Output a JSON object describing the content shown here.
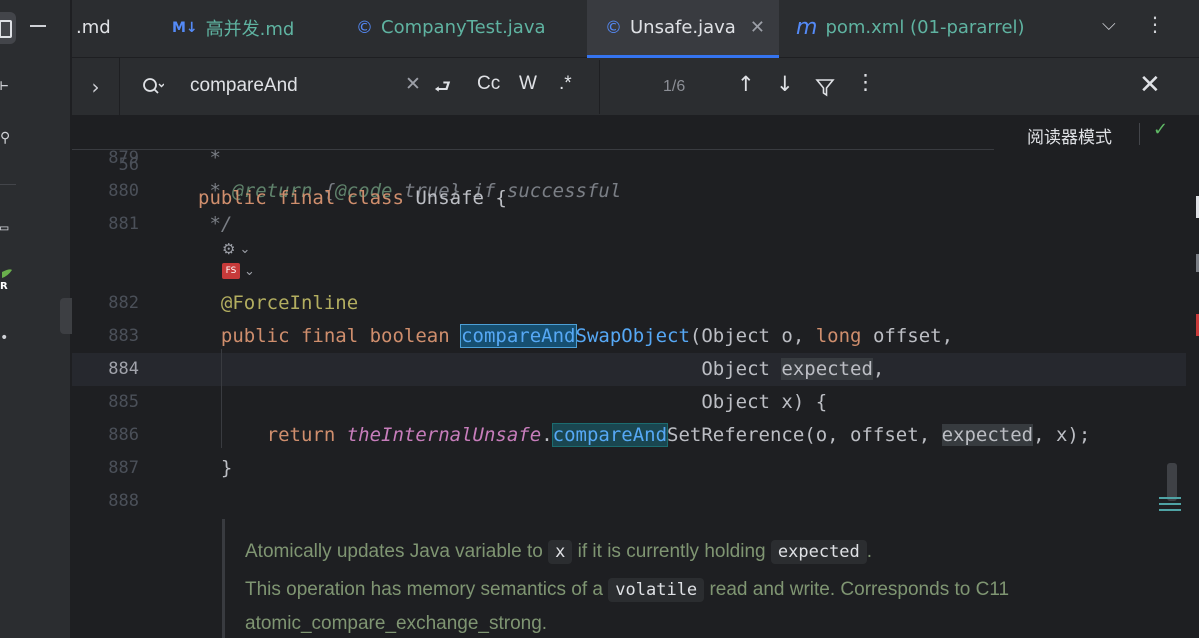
{
  "tabs": [
    {
      "label": ".md",
      "icon": "markdown-icon",
      "active": false
    },
    {
      "label": "高并发.md",
      "icon": "markdown-icon",
      "icon_glyph": "M↓",
      "active": false
    },
    {
      "label": "CompanyTest.java",
      "icon": "java-class-icon",
      "icon_glyph": "©",
      "active": false
    },
    {
      "label": "Unsafe.java",
      "icon": "java-class-icon",
      "icon_glyph": "©",
      "active": true
    },
    {
      "label": "pom.xml (01-pararrel)",
      "icon": "maven-icon",
      "icon_glyph": "m",
      "active": false
    }
  ],
  "search": {
    "query": "compareAnd",
    "options": {
      "regex_newline": "⮐",
      "match_case": "Cc",
      "whole_word": "W",
      "regex": ".*"
    },
    "match_count": "1/6"
  },
  "editor": {
    "sticky": {
      "line": "56",
      "tokens": [
        {
          "t": "public final class ",
          "c": "kw"
        },
        {
          "t": "Unsafe {",
          "c": ""
        }
      ]
    },
    "reader_mode_label": "阅读器模式",
    "lines": [
      {
        "n": "879",
        "tokens": [
          {
            "t": " *",
            "c": "cmt"
          }
        ]
      },
      {
        "n": "880",
        "tokens": [
          {
            "t": " * ",
            "c": "cmt"
          },
          {
            "t": "@return",
            "c": "doctag"
          },
          {
            "t": " {",
            "c": "cmt"
          },
          {
            "t": "@code",
            "c": "doctag"
          },
          {
            "t": " true} if successful",
            "c": "cmt"
          }
        ]
      },
      {
        "n": "881",
        "tokens": [
          {
            "t": " */",
            "c": "cmt"
          }
        ]
      },
      {
        "n": "882",
        "tokens": [
          {
            "t": "  @ForceInline",
            "c": "ann"
          }
        ]
      },
      {
        "n": "883",
        "tokens": [
          {
            "t": "  public final boolean ",
            "c": "kw"
          },
          {
            "t": "compareAnd",
            "c": "hl-a"
          },
          {
            "t": "SwapObject",
            "c": "fn"
          },
          {
            "t": "(Object o, ",
            "c": ""
          },
          {
            "t": "long",
            "c": "kw"
          },
          {
            "t": " offset,",
            "c": ""
          }
        ]
      },
      {
        "n": "884",
        "current": true,
        "tokens": [
          {
            "t": "                                            Object ",
            "c": ""
          },
          {
            "t": "expected",
            "c": "usage"
          },
          {
            "t": ",",
            "c": ""
          }
        ]
      },
      {
        "n": "885",
        "tokens": [
          {
            "t": "                                            Object x) {",
            "c": ""
          }
        ]
      },
      {
        "n": "886",
        "tokens": [
          {
            "t": "      ",
            "c": ""
          },
          {
            "t": "return ",
            "c": "kw"
          },
          {
            "t": "theInternalUnsafe",
            "c": "stat"
          },
          {
            "t": ".",
            "c": ""
          },
          {
            "t": "compareAnd",
            "c": "hl-b"
          },
          {
            "t": "SetReference(o, offset, ",
            "c": ""
          },
          {
            "t": "expected",
            "c": "usage"
          },
          {
            "t": ", x);",
            "c": ""
          }
        ]
      },
      {
        "n": "887",
        "tokens": [
          {
            "t": "  }",
            "c": ""
          }
        ]
      },
      {
        "n": "888",
        "tokens": []
      }
    ]
  },
  "doc": {
    "p1_before": "Atomically updates Java variable to",
    "p1_code1": "x",
    "p1_mid": "if it is currently holding",
    "p1_code2": "expected",
    "p1_after": ".",
    "p2_before": "This operation has memory semantics of a",
    "p2_code": "volatile",
    "p2_after": "read and write. Corresponds to C11",
    "p3": "atomic_compare_exchange_strong."
  },
  "colors": {
    "accent": "#3574f0",
    "keyword": "#cf8e6d",
    "function": "#56a8f5",
    "comment": "#7a7e85",
    "annotation": "#b3ae60",
    "static": "#c77dbb"
  }
}
